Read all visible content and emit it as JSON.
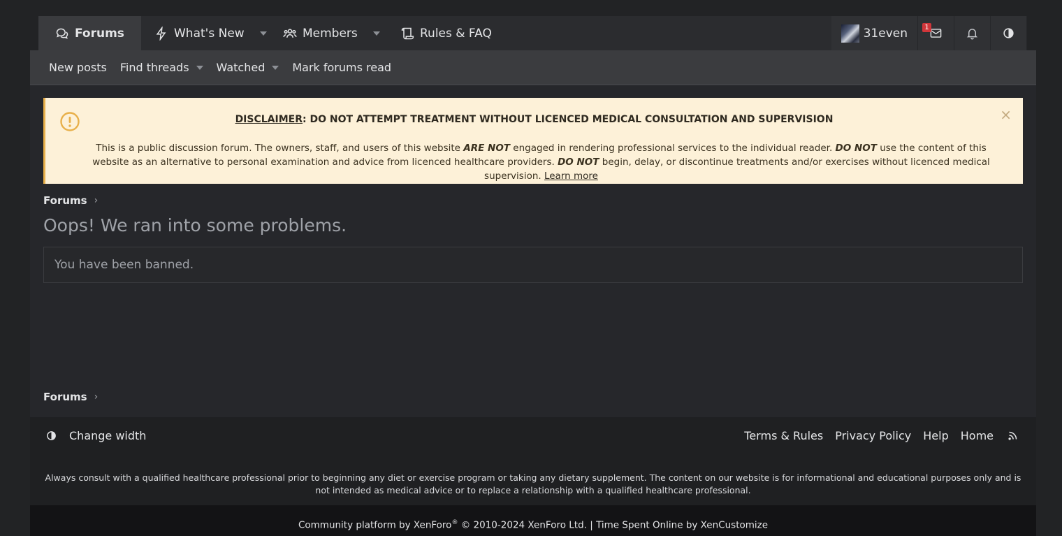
{
  "nav": {
    "tabs": [
      {
        "label": "Forums",
        "icon": "comments-icon"
      },
      {
        "label": "What's New",
        "icon": "bolt-icon"
      },
      {
        "label": "Members",
        "icon": "users-icon"
      },
      {
        "label": "Rules & FAQ",
        "icon": "scroll-icon"
      }
    ],
    "username": "31even",
    "conversations_badge": "1"
  },
  "subnav": {
    "items": [
      "New posts",
      "Find threads",
      "Watched",
      "Mark forums read"
    ]
  },
  "notice": {
    "title_prefix": "DISCLAIMER",
    "title_rest": ": DO NOT ATTEMPT TREATMENT WITHOUT LICENCED MEDICAL CONSULTATION AND SUPERVISION",
    "body_1": "This is a public discussion forum. The owners, staff, and users of this website ",
    "em_1": "ARE NOT",
    "body_2": " engaged in rendering professional services to the individual reader. ",
    "em_2": "DO NOT",
    "body_3": " use the content of this website as an alternative to personal examination and advice from licenced healthcare providers. ",
    "em_3": "DO NOT",
    "body_4": " begin, delay, or discontinue treatments and/or exercises without licenced medical supervision. ",
    "learn_more": "Learn more",
    "close": "×"
  },
  "breadcrumb": {
    "label": "Forums",
    "chevron": "›"
  },
  "page": {
    "title": "Oops! We ran into some problems.",
    "error": "You have been banned."
  },
  "footer": {
    "change_width": "Change width",
    "links": [
      "Terms & Rules",
      "Privacy Policy",
      "Help",
      "Home"
    ],
    "disclaimer": "Always consult with a qualified healthcare professional prior to beginning any diet or exercise program or taking any dietary supplement. The content on our website is for informational and educational purposes only and is not intended as medical advice or to replace a relationship with a qualified healthcare professional.",
    "copyright_1": "Community platform by XenForo",
    "copyright_reg": "®",
    "copyright_2": " © 2010-2024 XenForo Ltd. | Time Spent Online by XenCustomize"
  },
  "colors": {
    "background": "#222325",
    "notice_bg": "#fdf1d8",
    "notice_accent": "#e8b04a",
    "badge": "#d1363a"
  }
}
